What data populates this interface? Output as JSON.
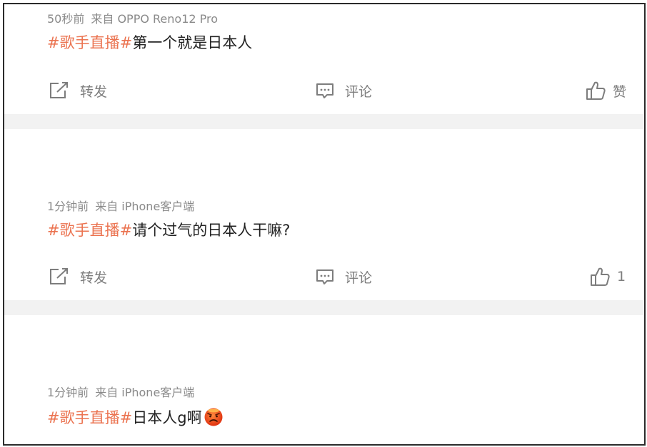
{
  "posts": [
    {
      "time": "50秒前",
      "source": "来自 OPPO Reno12 Pro",
      "topic": "#歌手直播#",
      "text": "第一个就是日本人",
      "actions": {
        "repost": "转发",
        "comment": "评论",
        "like": "赞"
      }
    },
    {
      "time": "1分钟前",
      "source": "来自 iPhone客户端",
      "topic": "#歌手直播#",
      "text": "请个过气的日本人干嘛?",
      "actions": {
        "repost": "转发",
        "comment": "评论",
        "like": "1"
      }
    },
    {
      "time": "1分钟前",
      "source": "来自 iPhone客户端",
      "topic": "#歌手直播#",
      "text": "日本人g啊",
      "emoji": "angry-face-emoji"
    }
  ],
  "icons": {
    "repost": "share-icon",
    "comment": "comment-icon",
    "like": "thumbs-up-icon"
  },
  "colors": {
    "topic": "#eb7350",
    "meta": "#8a8a8a",
    "divider": "#f2f2f2"
  }
}
